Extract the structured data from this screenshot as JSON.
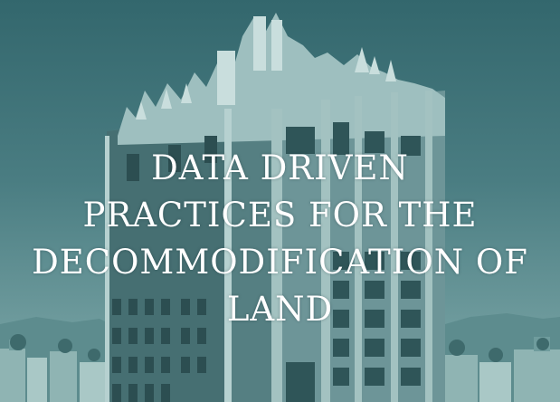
{
  "title": {
    "lines": [
      "DATA DRIVEN",
      "PRACTICES FOR THE",
      "DECOMMODIFICATION OF",
      "LAND"
    ]
  },
  "colors": {
    "tint": "#3f6f73",
    "building_light": "#c9dedd",
    "building_dark": "#2f5558",
    "text": "#ffffff"
  },
  "image": {
    "subject": "art-deco-tower-photo"
  }
}
